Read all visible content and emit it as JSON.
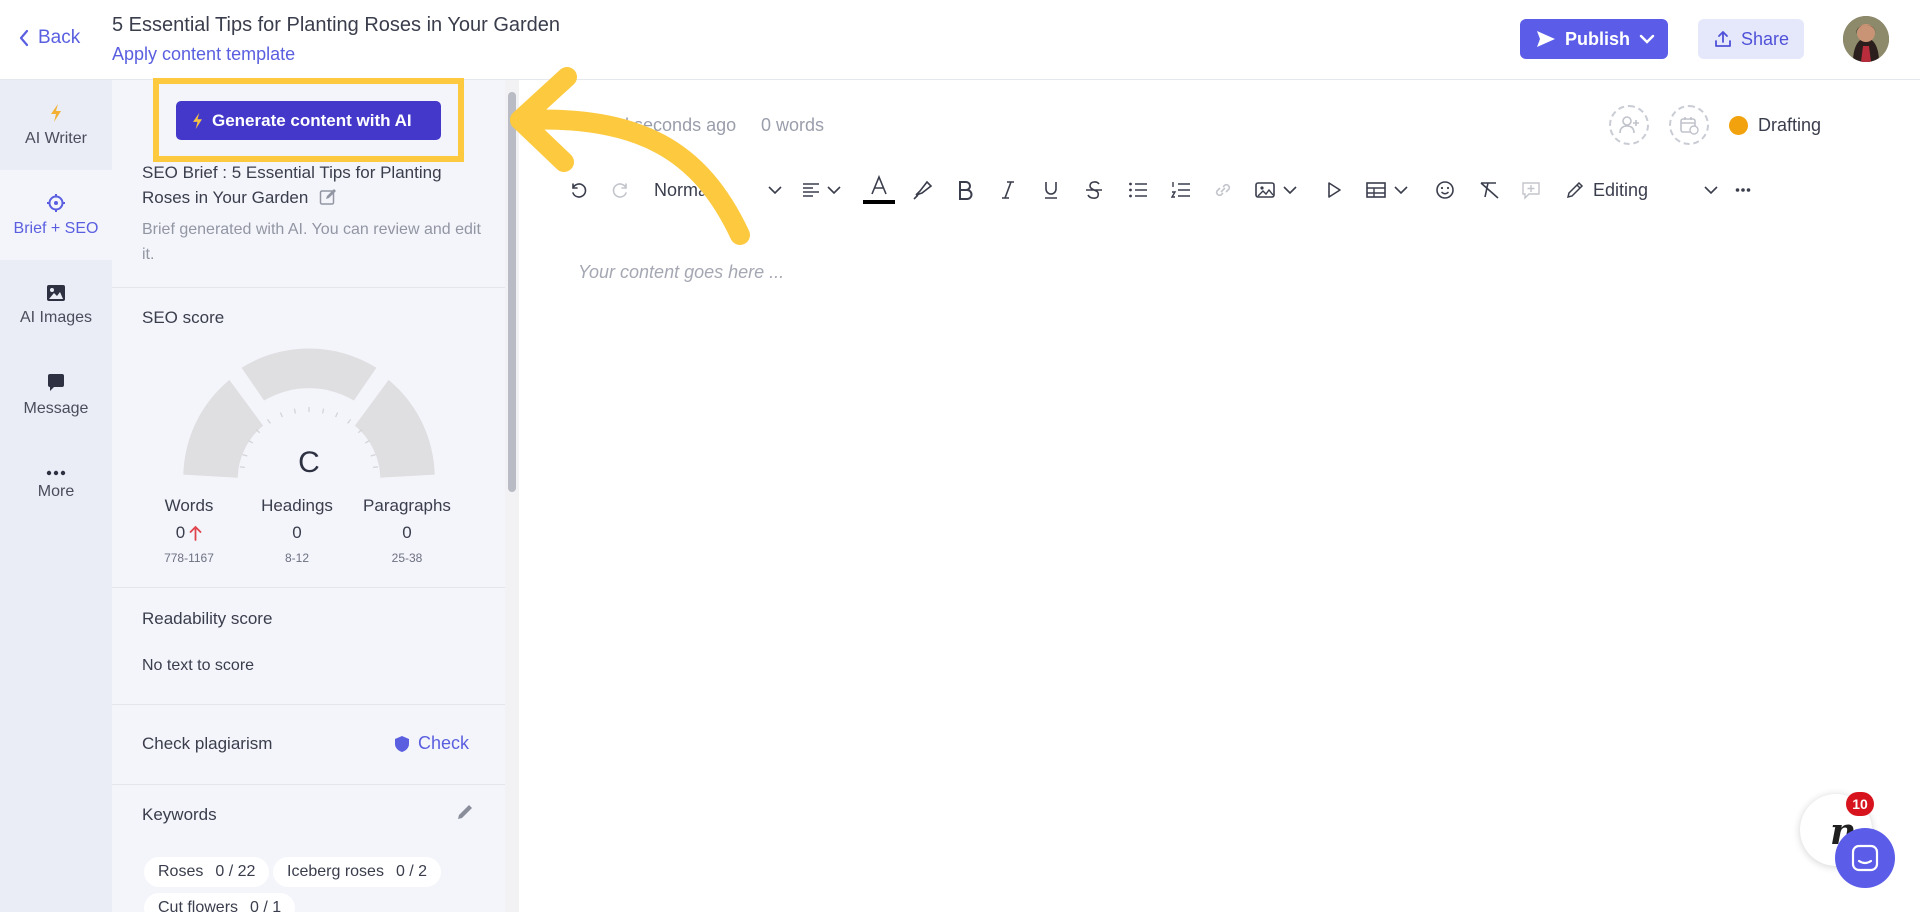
{
  "header": {
    "back_label": "Back",
    "title": "5 Essential Tips for Planting Roses in Your Garden",
    "template_link": "Apply content template",
    "publish_label": "Publish",
    "share_label": "Share"
  },
  "sidebar": {
    "items": [
      {
        "label": "AI Writer",
        "icon": "lightning-icon"
      },
      {
        "label": "Brief + SEO",
        "icon": "crosshair-icon",
        "active": true
      },
      {
        "label": "AI Images",
        "icon": "image-icon"
      },
      {
        "label": "Message",
        "icon": "message-icon"
      },
      {
        "label": "More",
        "icon": "more-icon"
      }
    ]
  },
  "panel": {
    "generate_label": "Generate content with AI",
    "brief_title": "SEO Brief : 5 Essential Tips for Planting Roses in Your Garden",
    "brief_desc": "Brief generated with AI. You can review and edit it.",
    "seo_heading": "SEO score",
    "seo_grade": "C",
    "stats": [
      {
        "label": "Words",
        "value": "0",
        "range": "778-1167"
      },
      {
        "label": "Headings",
        "value": "0",
        "range": "8-12"
      },
      {
        "label": "Paragraphs",
        "value": "0",
        "range": "25-38"
      }
    ],
    "readability_heading": "Readability score",
    "readability_text": "No text to score",
    "plagiarism_heading": "Check plagiarism",
    "check_label": "Check",
    "keywords_heading": "Keywords",
    "keywords": [
      {
        "name": "Roses",
        "count": "0 / 22"
      },
      {
        "name": "Iceberg roses",
        "count": "0 / 2"
      },
      {
        "name": "Cut flowers",
        "count": "0 / 1"
      }
    ]
  },
  "editor": {
    "saved_text": "Saved seconds ago",
    "word_count": "0 words",
    "status": "Drafting",
    "style_select": "Normal",
    "mode_label": "Editing",
    "placeholder": "Your content goes here ..."
  },
  "widgets": {
    "notification_count": "10",
    "n_logo": "n"
  },
  "colors": {
    "accent": "#5b5ce8",
    "highlight": "#fcc93f",
    "status_dot": "#f2a20c"
  }
}
